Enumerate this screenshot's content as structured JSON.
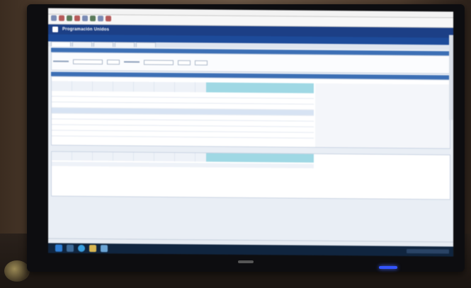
{
  "photo": {
    "subject": "Computer monitor displaying a Windows application"
  },
  "app": {
    "title": "Programación Unidos",
    "sub_code": "",
    "sub_description": "",
    "menu": [],
    "tabs": []
  },
  "sections": {
    "first": "",
    "second": ""
  },
  "taskbar_icons": [
    "start-icon",
    "task-view-icon",
    "internet-explorer-icon",
    "file-explorer-icon",
    "app-icon"
  ],
  "colors": {
    "title_bar": "#1c3f86",
    "highlight_columns": "#9fd8e4",
    "taskbar": "#10253f"
  }
}
